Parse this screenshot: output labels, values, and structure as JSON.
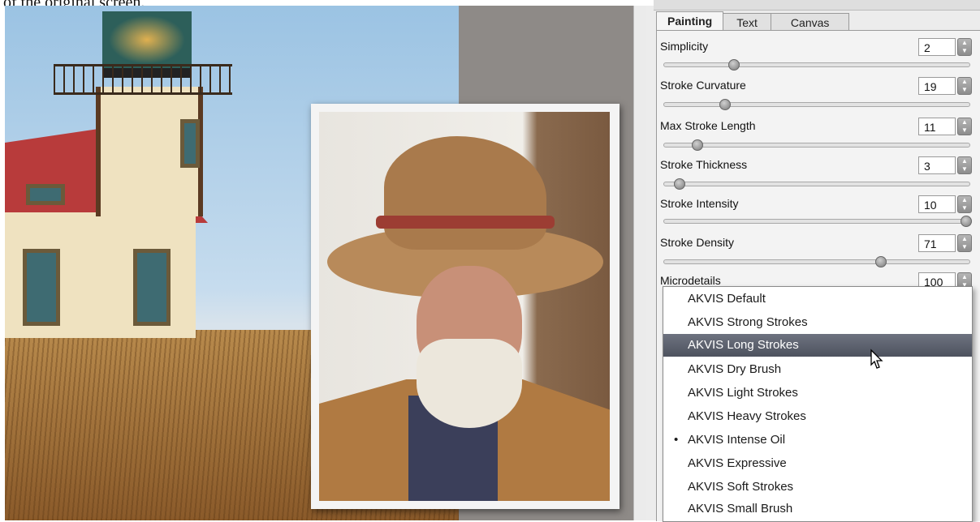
{
  "caption": "of the original screen.",
  "tabs": [
    "Painting",
    "Text",
    "Canvas"
  ],
  "active_tab": "Painting",
  "params": [
    {
      "label": "Simplicity",
      "value": "2",
      "level": 0.23
    },
    {
      "label": "Stroke Curvature",
      "value": "19",
      "level": 0.2
    },
    {
      "label": "Max Stroke Length",
      "value": "11",
      "level": 0.11
    },
    {
      "label": "Stroke Thickness",
      "value": "3",
      "level": 0.05
    },
    {
      "label": "Stroke Intensity",
      "value": "10",
      "level": 0.99
    },
    {
      "label": "Stroke Density",
      "value": "71",
      "level": 0.71
    },
    {
      "label": "Microdetails",
      "value": "100",
      "level": null
    }
  ],
  "presets": [
    {
      "label": "AKVIS Default",
      "current": false,
      "highlighted": false
    },
    {
      "label": "AKVIS Strong Strokes",
      "current": false,
      "highlighted": false
    },
    {
      "label": "AKVIS Long Strokes",
      "current": false,
      "highlighted": true
    },
    {
      "label": "AKVIS Dry Brush",
      "current": false,
      "highlighted": false
    },
    {
      "label": "AKVIS Light Strokes",
      "current": false,
      "highlighted": false
    },
    {
      "label": "AKVIS Heavy Strokes",
      "current": false,
      "highlighted": false
    },
    {
      "label": "AKVIS Intense Oil",
      "current": true,
      "highlighted": false
    },
    {
      "label": "AKVIS Expressive",
      "current": false,
      "highlighted": false
    },
    {
      "label": "AKVIS Soft Strokes",
      "current": false,
      "highlighted": false
    },
    {
      "label": "AKVIS Small Brush",
      "current": false,
      "highlighted": false
    }
  ],
  "bullet": "•",
  "colors": {
    "highlight": "#555a66",
    "panel": "#f3f3f3"
  }
}
